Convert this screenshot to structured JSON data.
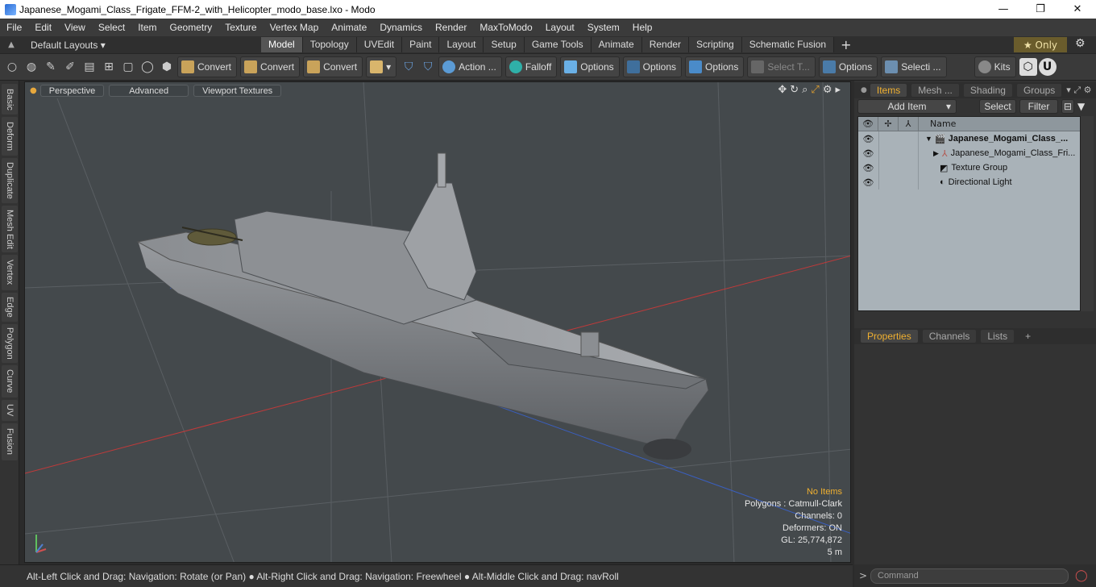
{
  "window": {
    "title": "Japanese_Mogami_Class_Frigate_FFM-2_with_Helicopter_modo_base.lxo - Modo",
    "minimize": "—",
    "maximize": "❐",
    "close": "✕"
  },
  "menu": [
    "File",
    "Edit",
    "View",
    "Select",
    "Item",
    "Geometry",
    "Texture",
    "Vertex Map",
    "Animate",
    "Dynamics",
    "Render",
    "MaxToModo",
    "Layout",
    "System",
    "Help"
  ],
  "layout_bar": {
    "layouts_label": "Default Layouts ▾",
    "tabs": [
      "Model",
      "Topology",
      "UVEdit",
      "Paint",
      "Layout",
      "Setup",
      "Game Tools",
      "Animate",
      "Render",
      "Scripting",
      "Schematic Fusion"
    ],
    "active_tab": "Model",
    "only_label": "★  Only"
  },
  "toolbar": {
    "convert1": "Convert",
    "convert2": "Convert",
    "convert3": "Convert",
    "action": "Action ...",
    "falloff": "Falloff",
    "options1": "Options",
    "options2": "Options",
    "options3": "Options",
    "select_t": "Select T...",
    "options4": "Options",
    "selecti": "Selecti ...",
    "kits": "Kits"
  },
  "left_tabs": [
    "Basic",
    "Deform",
    "Duplicate",
    "Mesh Edit",
    "Vertex",
    "Edge",
    "Polygon",
    "Curve",
    "UV",
    "Fusion"
  ],
  "viewport": {
    "tabs": [
      "Perspective",
      "Advanced",
      "Viewport Textures"
    ],
    "info": {
      "no_items": "No Items",
      "polygons": "Polygons : Catmull-Clark",
      "channels": "Channels: 0",
      "deformers": "Deformers: ON",
      "gl": "GL: 25,774,872",
      "scale": "5 m"
    }
  },
  "status_bar": "Alt-Left Click and Drag: Navigation: Rotate (or Pan) ● Alt-Right Click and Drag: Navigation: Freewheel ● Alt-Middle Click and Drag: navRoll",
  "items_panel": {
    "tabs": [
      "Items",
      "Mesh ...",
      "Shading",
      "Groups"
    ],
    "add_item": "Add Item",
    "select": "Select",
    "filter": "Filter",
    "name_header": "Name",
    "rows": [
      {
        "label": "Japanese_Mogami_Class_...",
        "indent": 0
      },
      {
        "label": "Japanese_Mogami_Class_Fri...",
        "indent": 1
      },
      {
        "label": "Texture Group",
        "indent": 1
      },
      {
        "label": "Directional Light",
        "indent": 1
      }
    ]
  },
  "props_panel": {
    "tabs": [
      "Properties",
      "Channels",
      "Lists"
    ]
  },
  "command_placeholder": "Command"
}
